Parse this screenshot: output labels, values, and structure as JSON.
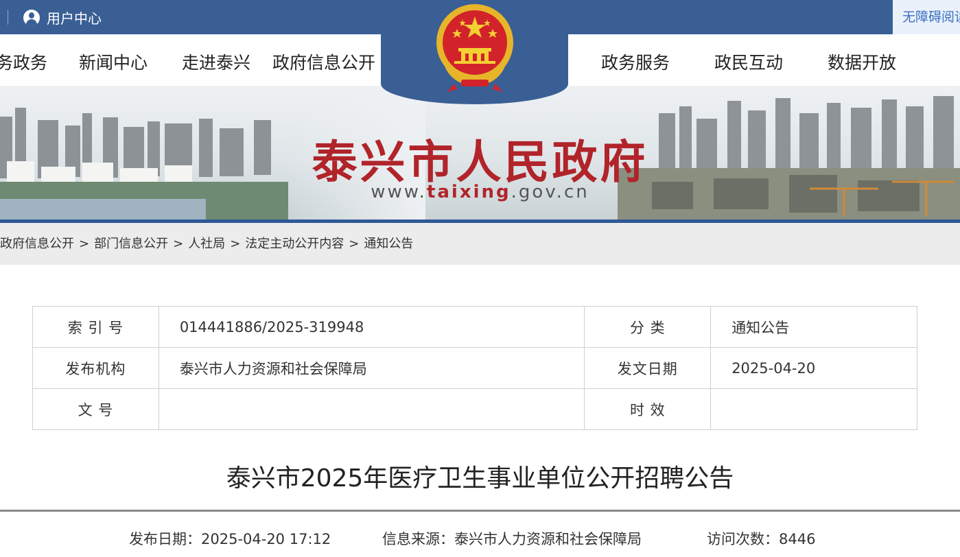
{
  "topbar": {
    "user_center": "用户中心",
    "accessibility": "无障碍阅读"
  },
  "nav": {
    "left": [
      "务政务",
      "新闻中心",
      "走进泰兴",
      "政府信息公开"
    ],
    "right": [
      "政务服务",
      "政民互动",
      "数据开放"
    ]
  },
  "banner": {
    "title": "泰兴市人民政府",
    "url_prefix": "www.",
    "url_highlight": "taixing",
    "url_suffix": ".gov.cn"
  },
  "breadcrumb": {
    "items": [
      "政府信息公开",
      "部门信息公开",
      "人社局",
      "法定主动公开内容",
      "通知公告"
    ],
    "separator": ">"
  },
  "meta": {
    "index_label": "索 引 号",
    "index_value": "014441886/2025-319948",
    "category_label": "分 类",
    "category_value": "通知公告",
    "publisher_label": "发布机构",
    "publisher_value": "泰兴市人力资源和社会保障局",
    "doc_date_label": "发文日期",
    "doc_date_value": "2025-04-20",
    "doc_no_label": "文 号",
    "doc_no_value": "",
    "validity_label": "时 效",
    "validity_value": ""
  },
  "article": {
    "title": "泰兴市2025年医疗卫生事业单位公开招聘公告",
    "publish_date": "发布日期：2025-04-20 17:12",
    "source": "信息来源：泰兴市人力资源和社会保障局",
    "views": "访问次数：8446"
  },
  "colors": {
    "brand_blue": "#3a5f95",
    "brand_red": "#b0242a"
  }
}
